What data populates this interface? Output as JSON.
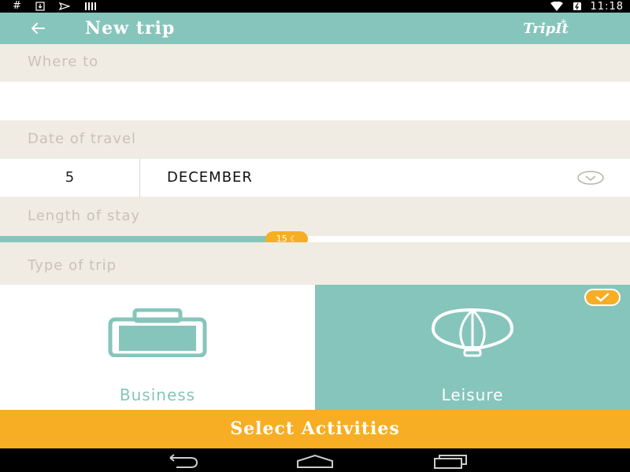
{
  "status_bar": {
    "left_icons": [
      "hash-icon",
      "download-icon",
      "paper-plane-icon",
      "signal-bars-icon"
    ],
    "right_icons": [
      "wifi-icon",
      "battery-icon"
    ],
    "time": "11:18"
  },
  "app_bar": {
    "title": "New trip",
    "brand": "TripIt",
    "back_icon": "back-arrow-icon"
  },
  "form": {
    "where_to": {
      "label": "Where to",
      "value": ""
    },
    "date_of_travel": {
      "label": "Date of travel",
      "day": "5",
      "month": "DECEMBER"
    },
    "length_of_stay": {
      "label": "Length of stay",
      "value": 15,
      "max": 33,
      "badge_text": "15"
    },
    "type_of_trip": {
      "label": "Type of trip",
      "options": [
        {
          "label": "Business",
          "icon": "suitcase-icon",
          "selected": false
        },
        {
          "label": "Leisure",
          "icon": "hot-air-balloon-icon",
          "selected": true
        }
      ]
    }
  },
  "cta": {
    "label": "Select Activities"
  },
  "nav_bar": {
    "buttons": [
      "back-nav-icon",
      "home-nav-icon",
      "recents-nav-icon"
    ]
  },
  "colors": {
    "teal": "#86c5bb",
    "orange": "#f7ae25",
    "band": "#f0ece4",
    "label_text": "#c8c2b8"
  }
}
